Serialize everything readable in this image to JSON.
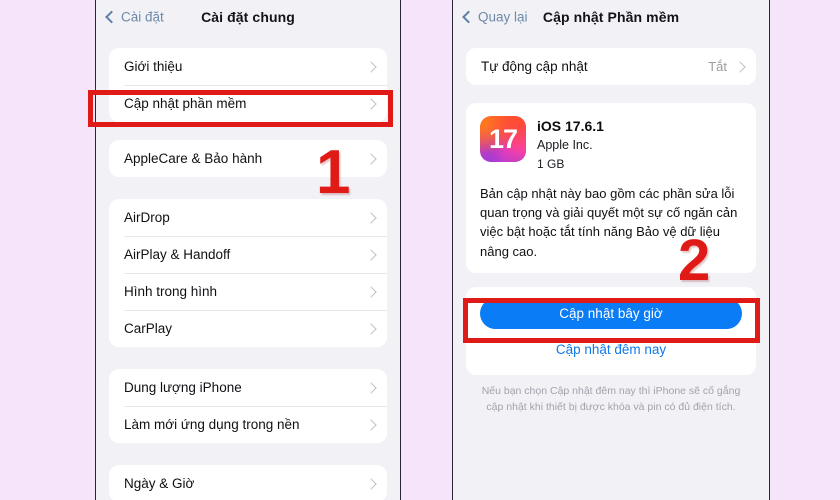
{
  "theme": {
    "page_background": "#f6e4fa",
    "panel_background": "#f2f1f6",
    "card_background": "#ffffff",
    "accent_blue": "#0a7cf5",
    "link_blue": "#1178e8",
    "annotation_red": "#e01b17"
  },
  "left_panel": {
    "nav": {
      "back_label": "Cài đặt",
      "title": "Cài đặt chung"
    },
    "groups": [
      {
        "rows": [
          {
            "label": "Giới thiệu",
            "value": ""
          },
          {
            "label": "Cập nhật phần mềm",
            "value": ""
          }
        ]
      },
      {
        "rows": [
          {
            "label": "AppleCare & Bảo hành",
            "value": ""
          }
        ]
      },
      {
        "rows": [
          {
            "label": "AirDrop",
            "value": ""
          },
          {
            "label": "AirPlay & Handoff",
            "value": ""
          },
          {
            "label": "Hình trong hình",
            "value": ""
          },
          {
            "label": "CarPlay",
            "value": ""
          }
        ]
      },
      {
        "rows": [
          {
            "label": "Dung lượng iPhone",
            "value": ""
          },
          {
            "label": "Làm mới ứng dụng trong nền",
            "value": ""
          }
        ]
      },
      {
        "rows": [
          {
            "label": "Ngày & Giờ",
            "value": ""
          }
        ]
      }
    ]
  },
  "right_panel": {
    "nav": {
      "back_label": "Quay lại",
      "title": "Cập nhật Phần mềm"
    },
    "auto_update_row": {
      "label": "Tự động cập nhật",
      "value": "Tắt"
    },
    "update": {
      "icon_label": "17",
      "version": "iOS 17.6.1",
      "vendor": "Apple Inc.",
      "size": "1 GB",
      "description": "Bản cập nhật này bao gồm các phần sửa lỗi quan trọng và giải quyết một sự cố ngăn cản việc bật hoặc tắt tính năng Bảo vệ dữ liệu nâng cao."
    },
    "actions": {
      "primary_label": "Cập nhật bây giờ",
      "secondary_label": "Cập nhật đêm nay"
    },
    "footnote": "Nếu bạn chọn Cập nhật đêm nay thì iPhone sẽ cố gắng cập nhật khi thiết bị được khóa và pin có đủ điện tích."
  },
  "annotations": {
    "step_one": "1",
    "step_two": "2"
  }
}
